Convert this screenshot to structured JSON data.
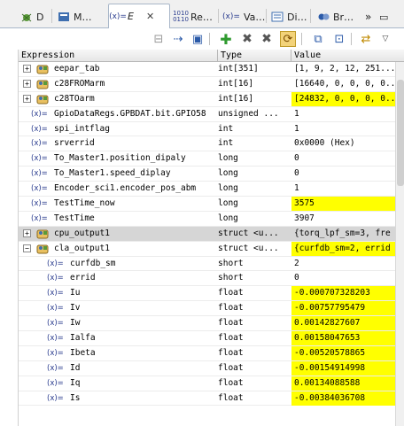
{
  "tabs": [
    {
      "label": "D",
      "icon": "debug-icon"
    },
    {
      "label": "M…",
      "icon": "memory-icon"
    },
    {
      "label": "E",
      "icon": "expressions-icon",
      "active": true
    },
    {
      "label": "Re…",
      "icon": "registers-icon"
    },
    {
      "label": "Va…",
      "icon": "variables-icon"
    },
    {
      "label": "Di…",
      "icon": "disassembly-icon"
    },
    {
      "label": "Br…",
      "icon": "breakpoints-icon"
    }
  ],
  "columns": {
    "expression": "Expression",
    "type": "Type",
    "value": "Value"
  },
  "rows": [
    {
      "kind": "struct",
      "expander": "+",
      "indent": 0,
      "name": "eepar_tab",
      "type": "int[351]",
      "value": "[1, 9, 2, 12, 251...]",
      "hl": false
    },
    {
      "kind": "struct",
      "expander": "+",
      "indent": 0,
      "name": "c28FROMarm",
      "type": "int[16]",
      "value": "[16640, 0, 0, 0, 0...",
      "hl": false
    },
    {
      "kind": "struct",
      "expander": "+",
      "indent": 0,
      "name": "c28TOarm",
      "type": "int[16]",
      "value": "[24832, 0, 0, 0, 0...]",
      "hl": true
    },
    {
      "kind": "var",
      "indent": 0,
      "name": "GpioDataRegs.GPBDAT.bit.GPIO58",
      "type": "unsigned ...",
      "value": "1",
      "hl": false
    },
    {
      "kind": "var",
      "indent": 0,
      "name": "spi_intflag",
      "type": "int",
      "value": "1",
      "hl": false
    },
    {
      "kind": "var",
      "indent": 0,
      "name": "srverrid",
      "type": "int",
      "value": "0x0000 (Hex)",
      "hl": false
    },
    {
      "kind": "var",
      "indent": 0,
      "name": "To_Master1.position_dipaly",
      "type": "long",
      "value": "0",
      "hl": false
    },
    {
      "kind": "var",
      "indent": 0,
      "name": "To_Master1.speed_diplay",
      "type": "long",
      "value": "0",
      "hl": false
    },
    {
      "kind": "var",
      "indent": 0,
      "name": "Encoder_sci1.encoder_pos_abm",
      "type": "long",
      "value": "1",
      "hl": false
    },
    {
      "kind": "var",
      "indent": 0,
      "name": "TestTime_now",
      "type": "long",
      "value": "3575",
      "hl": true
    },
    {
      "kind": "var",
      "indent": 0,
      "name": "TestTime",
      "type": "long",
      "value": "3907",
      "hl": false
    },
    {
      "kind": "struct",
      "expander": "+",
      "indent": 0,
      "name": "cpu_output1",
      "type": "struct <u...",
      "value": "{torq_lpf_sm=3, fre",
      "hl": false,
      "sel": true
    },
    {
      "kind": "struct",
      "expander": "−",
      "indent": 0,
      "name": "cla_output1",
      "type": "struct <u...",
      "value": "{curfdb_sm=2, errid",
      "hl": true
    },
    {
      "kind": "var",
      "indent": 1,
      "name": "curfdb_sm",
      "type": "short",
      "value": "2",
      "hl": false
    },
    {
      "kind": "var",
      "indent": 1,
      "name": "errid",
      "type": "short",
      "value": "0",
      "hl": false
    },
    {
      "kind": "var",
      "indent": 1,
      "name": "Iu",
      "type": "float",
      "value": "-0.000707328203",
      "hl": true
    },
    {
      "kind": "var",
      "indent": 1,
      "name": "Iv",
      "type": "float",
      "value": "-0.00757795479",
      "hl": true
    },
    {
      "kind": "var",
      "indent": 1,
      "name": "Iw",
      "type": "float",
      "value": "0.00142827607",
      "hl": true
    },
    {
      "kind": "var",
      "indent": 1,
      "name": "Ialfa",
      "type": "float",
      "value": "0.00158047653",
      "hl": true
    },
    {
      "kind": "var",
      "indent": 1,
      "name": "Ibeta",
      "type": "float",
      "value": "-0.00520578865",
      "hl": true
    },
    {
      "kind": "var",
      "indent": 1,
      "name": "Id",
      "type": "float",
      "value": "-0.00154914998",
      "hl": true
    },
    {
      "kind": "var",
      "indent": 1,
      "name": "Iq",
      "type": "float",
      "value": "0.00134088588",
      "hl": true
    },
    {
      "kind": "var",
      "indent": 1,
      "name": "Is",
      "type": "float",
      "value": "-0.00384036708",
      "hl": true
    }
  ],
  "colors": {
    "highlight": "#ffff00",
    "selected": "#d6d6d6",
    "var_icon": "#2b3d8f"
  }
}
